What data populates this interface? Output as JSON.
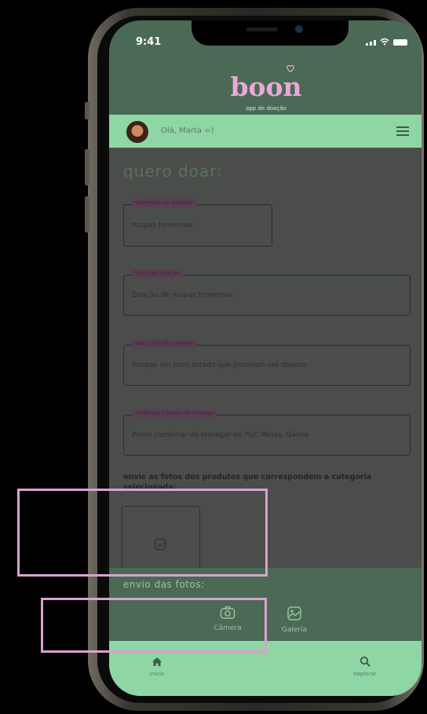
{
  "status_bar": {
    "time": "9:41"
  },
  "brand": {
    "name": "boon",
    "tagline": "app de doação"
  },
  "user_bar": {
    "greeting": "Olá, Marta =)"
  },
  "page": {
    "title": "quero doar:",
    "fields": [
      {
        "label": "categoria do produto",
        "value": "roupas femininas"
      },
      {
        "label": "título da doação",
        "value": "Doação de roupas femininas"
      },
      {
        "label": "descrição do produto",
        "value": "Roupas em bom estado que precisam ser doadas"
      },
      {
        "label": "endereço / ponto de entrega",
        "value": "Posso combinar de entregar no PUC Minas, Gávea"
      }
    ],
    "photo_instruction": "envie as fotos dos produtos que correspondem a categoria selecionada:"
  },
  "upload_panel": {
    "title": "envio das fotos:",
    "options": [
      {
        "label": "Câmera",
        "icon": "camera-icon"
      },
      {
        "label": "Galeria",
        "icon": "gallery-icon"
      }
    ]
  },
  "tab_bar": {
    "tabs": [
      {
        "label": "início",
        "icon": "home-icon"
      },
      {
        "label": "explorar",
        "icon": "search-icon"
      }
    ]
  },
  "colors": {
    "header_green": "#4a6a55",
    "mint": "#8fd6a5",
    "logo_pink": "#e9a9d8",
    "highlight": "#d9a2cf"
  }
}
